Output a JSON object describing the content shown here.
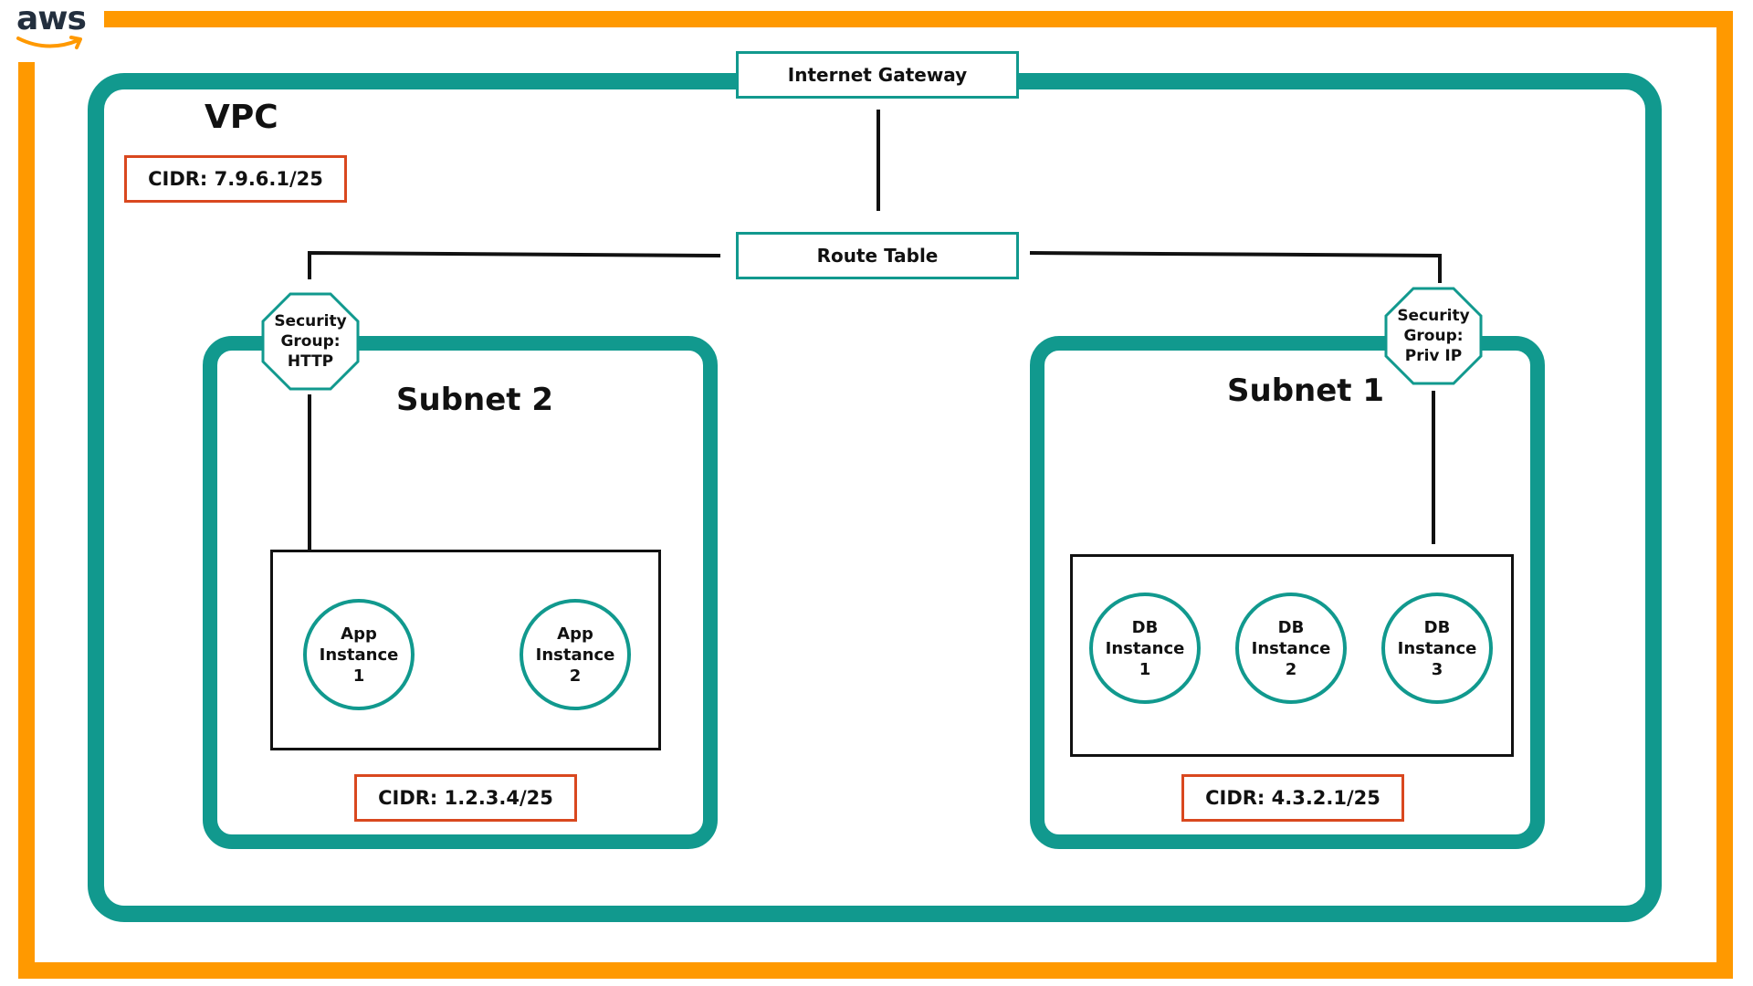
{
  "logo": {
    "text": "aws"
  },
  "colors": {
    "aws_orange": "#ff9900",
    "teal": "#11998e",
    "cidr_red": "#d9481f",
    "line_black": "#111111"
  },
  "vpc": {
    "title": "VPC",
    "cidr": "CIDR: 7.9.6.1/25"
  },
  "internet_gateway": {
    "label": "Internet Gateway"
  },
  "route_table": {
    "label": "Route Table"
  },
  "subnet_2": {
    "title": "Subnet 2",
    "security_group": "Security\nGroup:\nHTTP",
    "instances": [
      "App\nInstance\n1",
      "App\nInstance\n2"
    ],
    "cidr": "CIDR: 1.2.3.4/25"
  },
  "subnet_1": {
    "title": "Subnet 1",
    "security_group": "Security\nGroup:\nPriv IP",
    "instances": [
      "DB\nInstance\n1",
      "DB\nInstance\n2",
      "DB\nInstance\n3"
    ],
    "cidr": "CIDR: 4.3.2.1/25"
  }
}
